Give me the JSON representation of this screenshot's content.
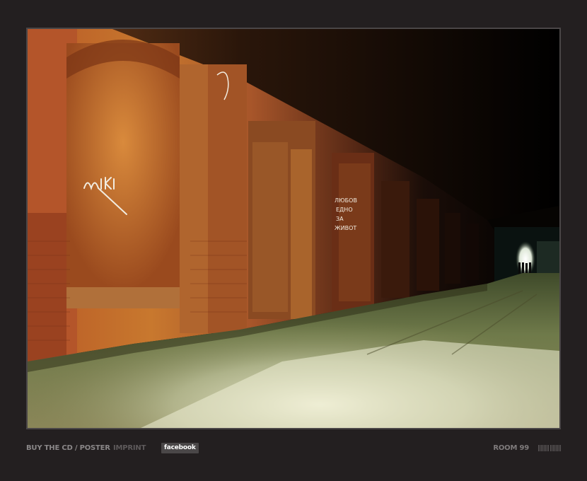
{
  "photo": {
    "alt": "",
    "graffiti": [
      "MIKI",
      "ЛЮБОВ",
      "ЕДНО",
      "ЗА",
      "ЖИВОТ"
    ]
  },
  "footer": {
    "buy_label": "BUY THE CD / POSTER",
    "imprint_label": "IMPRINT",
    "facebook_label": "facebook",
    "room_label": "ROOM 99",
    "progress_icon": "thumbnail-strip-icon",
    "progress_ticks": 16
  },
  "colors": {
    "background": "#231f20",
    "frame_border": "#4a4647",
    "link_primary": "#8a8788",
    "link_dim": "#5e5a5b",
    "facebook_bg": "#4a4748"
  }
}
